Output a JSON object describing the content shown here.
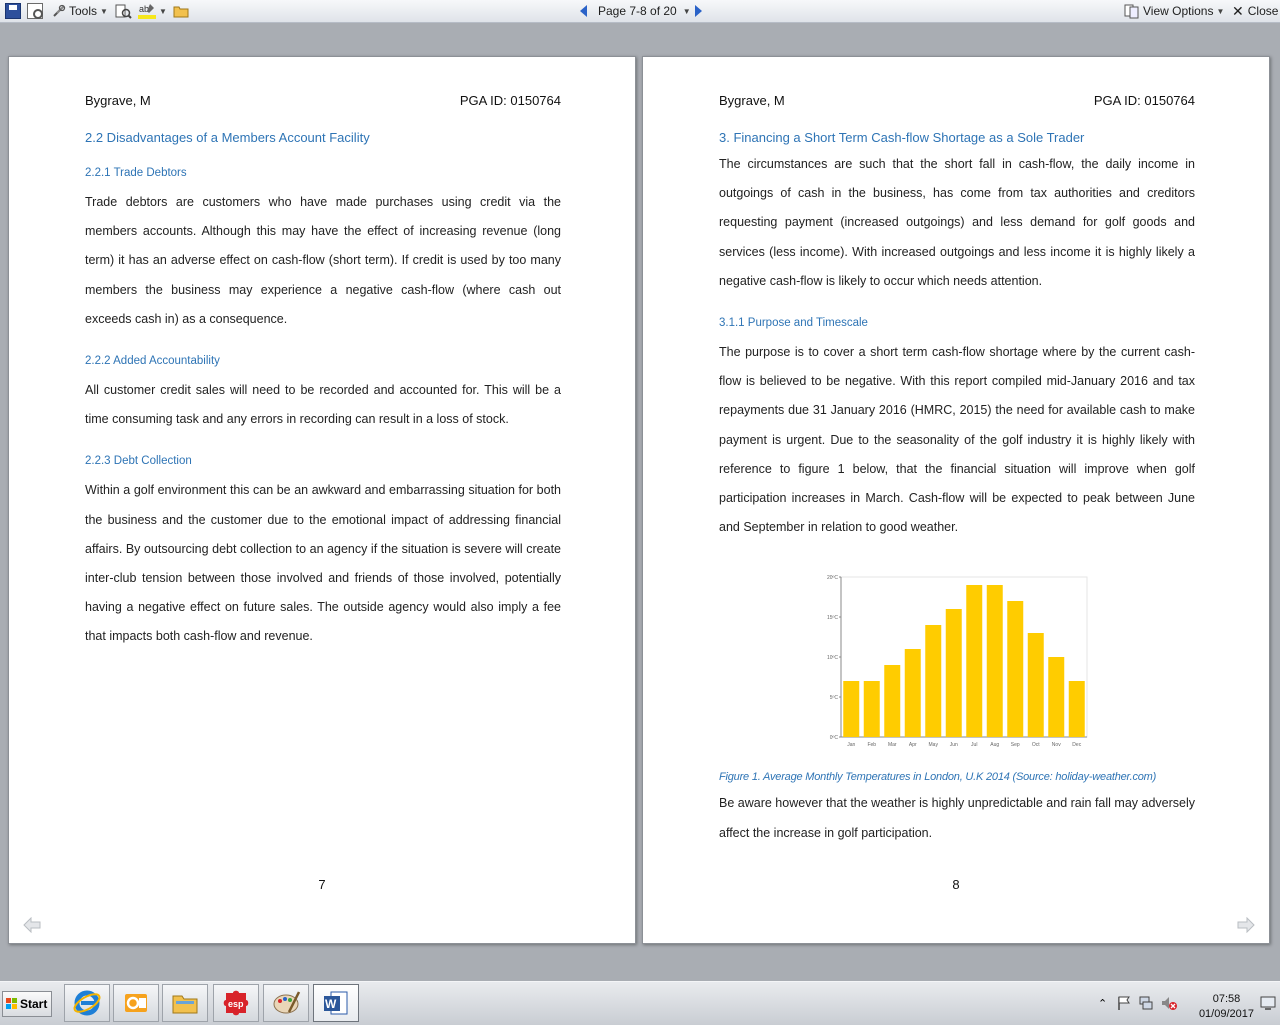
{
  "toolbar": {
    "tools_label": "Tools",
    "page_indicator": "Page 7-8 of 20",
    "view_options_label": "View Options",
    "close_label": "Close"
  },
  "page_left": {
    "header_left": "Bygrave, M",
    "header_right": "PGA ID: 0150764",
    "h_2_2": "2.2 Disadvantages of a Members Account Facility",
    "h_2_2_1": "2.2.1 Trade Debtors",
    "p_2_2_1": "Trade debtors are customers who have made purchases using credit via the members accounts. Although this may have the effect of increasing revenue (long term) it has an adverse effect on cash-flow (short term). If credit is used by too many members the business may experience a negative cash-flow (where cash out exceeds cash in) as a consequence.",
    "h_2_2_2": "2.2.2 Added Accountability",
    "p_2_2_2": "All customer credit sales will need to be recorded and accounted for. This will be a time consuming task and any errors in recording can result in a loss of stock.",
    "h_2_2_3": "2.2.3 Debt Collection",
    "p_2_2_3": "Within a golf environment this can be an awkward and embarrassing situation for both the business and the customer due to the emotional impact of addressing financial affairs. By outsourcing debt collection to an agency if the situation is severe will create inter-club tension between those involved and friends of those involved, potentially having a negative effect on future sales. The outside agency would also imply a fee that impacts both cash-flow and revenue.",
    "page_number": "7"
  },
  "page_right": {
    "header_left": "Bygrave, M",
    "header_right": "PGA ID: 0150764",
    "h_3": "3. Financing a Short Term Cash-flow Shortage as a Sole Trader",
    "p_3": "The circumstances are such that the short fall in cash-flow, the daily income in outgoings of cash in the business, has come from tax authorities and creditors requesting payment (increased outgoings) and less demand for golf goods and services (less income). With increased outgoings and less income it is highly likely a negative cash-flow is likely to occur which needs attention.",
    "h_3_1_1": "3.1.1 Purpose and Timescale",
    "p_3_1_1": "The purpose is to cover a short term cash-flow shortage where by the current cash-flow is believed to be negative. With this report compiled mid-January 2016 and tax repayments due 31 January 2016 (HMRC, 2015) the need for available cash to make payment is urgent. Due to the seasonality of the golf industry it is highly likely with reference to figure 1 below, that the financial situation will improve when golf participation increases in March. Cash-flow will be expected to peak between June and September in relation to good weather.",
    "caption": "Figure 1. Average Monthly Temperatures in London, U.K 2014 (Source: holiday-weather.com)",
    "p_after": "Be aware however that the weather is highly unpredictable and rain fall may adversely affect the increase in golf participation.",
    "page_number": "8"
  },
  "chart_data": {
    "type": "bar",
    "categories": [
      "Jan",
      "Feb",
      "Mar",
      "Apr",
      "May",
      "Jun",
      "Jul",
      "Aug",
      "Sep",
      "Oct",
      "Nov",
      "Dec"
    ],
    "values": [
      7,
      7,
      9,
      11,
      14,
      16,
      19,
      19,
      17,
      13,
      10,
      7
    ],
    "ylim": [
      0,
      20
    ],
    "yticks": [
      "0ºC",
      "5ºC",
      "10ºC",
      "15ºC",
      "20ºC"
    ],
    "grid": false,
    "bar_color": "#ffcc00"
  },
  "taskbar": {
    "start_label": "Start",
    "time": "07:58",
    "date": "01/09/2017"
  },
  "colors": {
    "heading": "#2e74b5",
    "accent_blue": "#2a62c8"
  }
}
